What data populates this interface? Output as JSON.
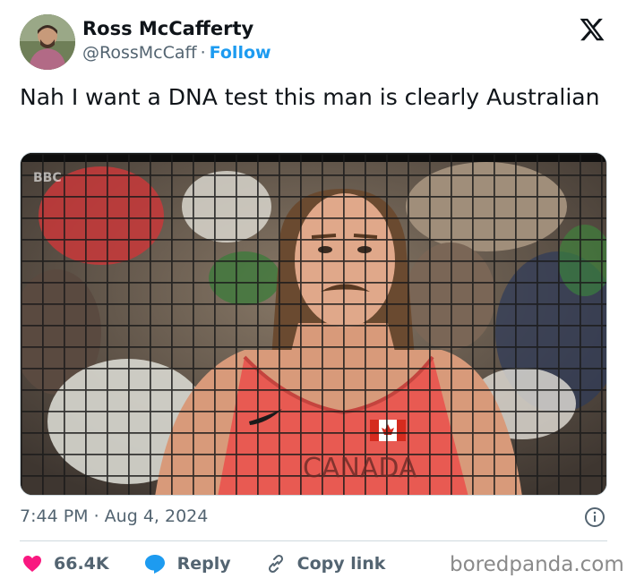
{
  "author": {
    "display_name": "Ross McCafferty",
    "handle": "@RossMcCaff",
    "separator": "·",
    "follow_label": "Follow"
  },
  "tweet": {
    "text": "Nah I want a DNA test this man is clearly Australian",
    "timestamp": "7:44 PM · Aug 4, 2024"
  },
  "media": {
    "broadcaster_logo": "BBC",
    "jersey_text": "CANADA"
  },
  "actions": {
    "likes": "66.4K",
    "reply_label": "Reply",
    "copy_link_label": "Copy link"
  },
  "watermark": "boredpanda.com",
  "icons": [
    "x-logo-icon",
    "info-icon",
    "heart-icon",
    "reply-bubble-icon",
    "link-icon"
  ],
  "colors": {
    "accent": "#1d9bf0",
    "like": "#f91880",
    "text": "#0f1419",
    "muted": "#536471"
  }
}
